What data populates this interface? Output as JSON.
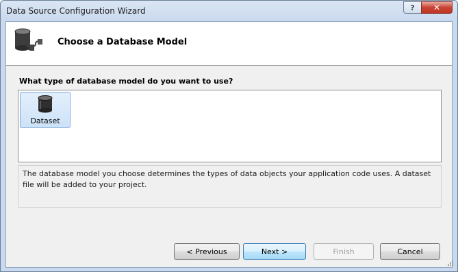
{
  "window": {
    "title": "Data Source Configuration Wizard",
    "help_label": "?",
    "close_label": "✕"
  },
  "header": {
    "title": "Choose a Database Model",
    "icon": "database-connect-icon"
  },
  "question": "What type of database model do you want to use?",
  "models": [
    {
      "label": "Dataset",
      "icon": "database-icon",
      "selected": true
    }
  ],
  "description": "The database model you choose determines the types of data objects your application code uses. A dataset file will be added to your project.",
  "buttons": {
    "previous": "< Previous",
    "next": "Next >",
    "finish": "Finish",
    "cancel": "Cancel"
  },
  "colors": {
    "selection_bg": "#cde2f8",
    "selection_border": "#84acdd",
    "default_button_border": "#3c7fb1"
  }
}
